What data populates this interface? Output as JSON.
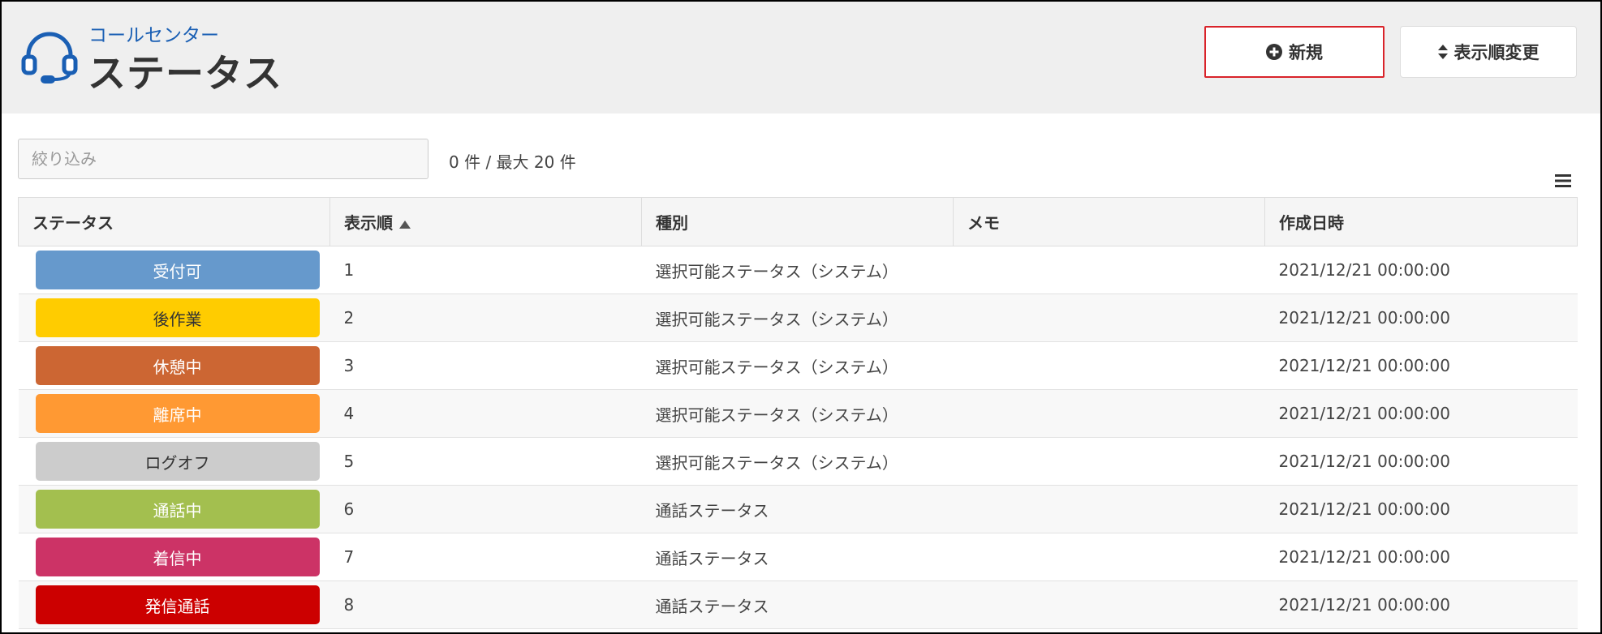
{
  "header": {
    "subtitle": "コールセンター",
    "title": "ステータス",
    "new_button": "新規",
    "order_button": "表示順変更"
  },
  "filter": {
    "placeholder": "絞り込み",
    "value": ""
  },
  "count_text": "0 件 / 最大 20 件",
  "table": {
    "columns": [
      "ステータス",
      "表示順",
      "種別",
      "メモ",
      "作成日時"
    ],
    "rows": [
      {
        "status": "受付可",
        "order": "1",
        "type": "選択可能ステータス（システム）",
        "memo": "",
        "created": "2021/12/21 00:00:00",
        "bg": "#6699cc",
        "fg": "#ffffff"
      },
      {
        "status": "後作業",
        "order": "2",
        "type": "選択可能ステータス（システム）",
        "memo": "",
        "created": "2021/12/21 00:00:00",
        "bg": "#ffcc00",
        "fg": "#333333"
      },
      {
        "status": "休憩中",
        "order": "3",
        "type": "選択可能ステータス（システム）",
        "memo": "",
        "created": "2021/12/21 00:00:00",
        "bg": "#cc6633",
        "fg": "#ffffff"
      },
      {
        "status": "離席中",
        "order": "4",
        "type": "選択可能ステータス（システム）",
        "memo": "",
        "created": "2021/12/21 00:00:00",
        "bg": "#ff9933",
        "fg": "#ffffff"
      },
      {
        "status": "ログオフ",
        "order": "5",
        "type": "選択可能ステータス（システム）",
        "memo": "",
        "created": "2021/12/21 00:00:00",
        "bg": "#cccccc",
        "fg": "#333333"
      },
      {
        "status": "通話中",
        "order": "6",
        "type": "通話ステータス",
        "memo": "",
        "created": "2021/12/21 00:00:00",
        "bg": "#a3bf4f",
        "fg": "#ffffff"
      },
      {
        "status": "着信中",
        "order": "7",
        "type": "通話ステータス",
        "memo": "",
        "created": "2021/12/21 00:00:00",
        "bg": "#cc3366",
        "fg": "#ffffff"
      },
      {
        "status": "発信通話",
        "order": "8",
        "type": "通話ステータス",
        "memo": "",
        "created": "2021/12/21 00:00:00",
        "bg": "#cc0000",
        "fg": "#ffffff"
      }
    ]
  },
  "colors": {
    "header_bg": "#efefef",
    "subtitle": "#1a5fb4",
    "logo": "#1a5fb4",
    "highlight_border": "#d9232a"
  },
  "icons": {
    "logo": "headset-icon",
    "new": "plus-circle-icon",
    "order": "sort-icon",
    "menu": "hamburger-menu-icon",
    "sort": "sort-ascending-icon"
  }
}
